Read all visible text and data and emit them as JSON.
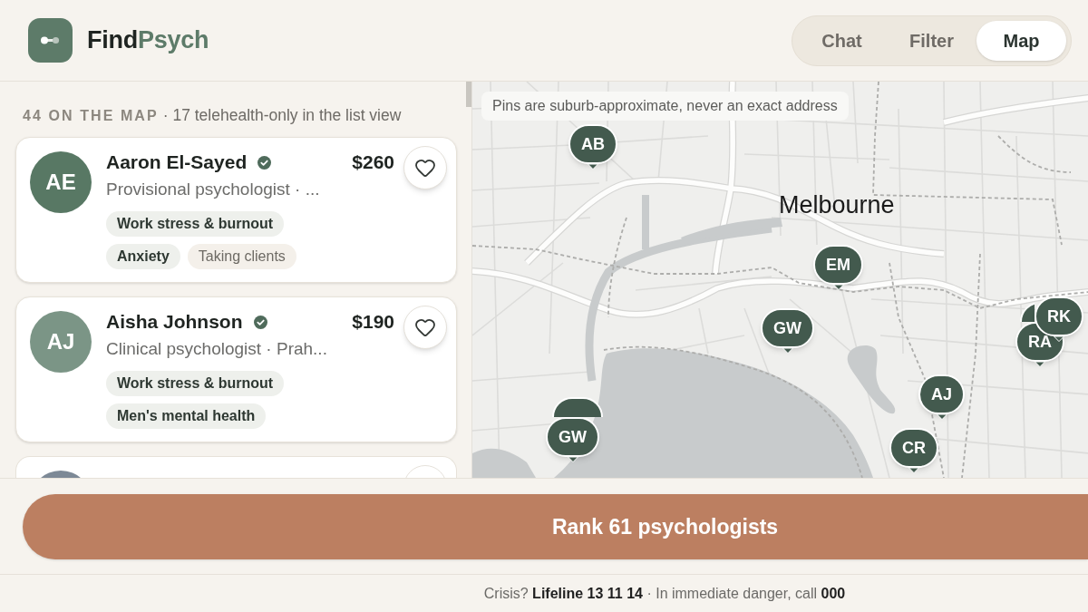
{
  "brand": {
    "name": "Find",
    "accent": "Psych"
  },
  "tabs": [
    {
      "label": "Chat",
      "selected": false
    },
    {
      "label": "Filter",
      "selected": false
    },
    {
      "label": "Map",
      "selected": true
    }
  ],
  "summary": {
    "count": "44 ON THE MAP",
    "note": "· 17 telehealth-only in the list view"
  },
  "cards": [
    {
      "kind": "full",
      "initials": "AE",
      "color": "#587864",
      "name": "Aaron El-Sayed",
      "verified": true,
      "price": "$260",
      "role": "Provisional psychologist · ...",
      "favorite": false,
      "tags": [
        {
          "kind": "specialty",
          "label": "Work stress & burnout"
        },
        {
          "kind": "specialty",
          "label": "Anxiety"
        },
        {
          "kind": "status",
          "label": "Taking clients"
        }
      ]
    },
    {
      "kind": "full",
      "initials": "AJ",
      "color": "#7b9586",
      "name": "Aisha Johnson",
      "verified": true,
      "price": "$190",
      "role": "Clinical psychologist · Prah...",
      "favorite": false,
      "tags": [
        {
          "kind": "specialty",
          "label": "Work stress & burnout"
        },
        {
          "kind": "specialty",
          "label": "Men's mental health"
        }
      ]
    },
    {
      "kind": "clipped",
      "color": "#7d8996"
    }
  ],
  "map": {
    "notice": "Pins are suburb-approximate, never an exact address",
    "city_label": "Melbourne",
    "pins": [
      {
        "kind": "covered"
      },
      {
        "kind": "covered"
      },
      {
        "kind": "labelled",
        "label": "AB"
      },
      {
        "kind": "labelled",
        "label": "EM"
      },
      {
        "kind": "labelled",
        "label": "GW"
      },
      {
        "kind": "labelled",
        "label": "RA"
      },
      {
        "kind": "labelled",
        "label": "RK"
      },
      {
        "kind": "labelled",
        "label": "AJ"
      },
      {
        "kind": "labelled",
        "label": "CR"
      },
      {
        "kind": "labelled",
        "label": "GW"
      }
    ]
  },
  "rank_button": "Rank 61 psychologists",
  "crisis_line": "Crisis? **Lifeline 13 11 14** · In immediate danger, call **000**"
}
